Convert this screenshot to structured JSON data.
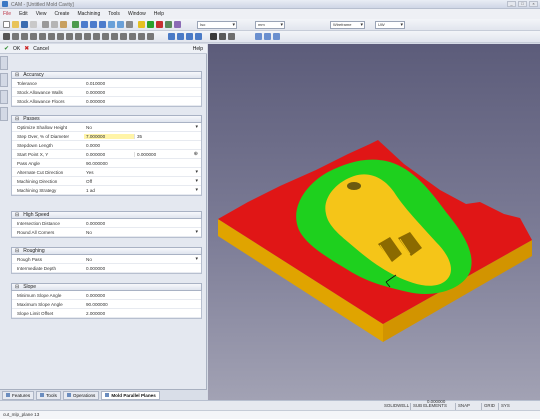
{
  "window": {
    "title": "CAM - [Untitled Mold Cavity]",
    "buttons": [
      "_",
      "□",
      "×"
    ]
  },
  "menu": [
    "File",
    "Edit",
    "View",
    "Create",
    "Machining",
    "Tools",
    "Window",
    "Help"
  ],
  "toolbar2": {
    "combo_view": "Iso",
    "combo_units": "mm",
    "combo_mode": "Wireframe",
    "combo_layer": "UW"
  },
  "panel": {
    "ok_label": "OK",
    "cancel_label": "Cancel",
    "help_label": "Help",
    "groups": {
      "accuracy": {
        "title": "Accuracy",
        "rows": [
          {
            "label": "Tolerance",
            "value": "0.010000"
          },
          {
            "label": "Stock Allowance Walls",
            "value": "0.000000"
          },
          {
            "label": "Stock Allowance Floors",
            "value": "0.000000"
          }
        ]
      },
      "passes": {
        "title": "Passes",
        "rows": [
          {
            "label": "Optimize Shallow Height",
            "value": "No"
          },
          {
            "label": "Step Over, % of Diameter",
            "value": "7.000000",
            "value2": "35"
          },
          {
            "label": "Stepdown Length",
            "value": "0.0000"
          },
          {
            "label": "Start Point X, Y",
            "value": "0.000000",
            "value2": "0.000000"
          },
          {
            "label": "Pass Angle",
            "value": "90.000000"
          },
          {
            "label": "Alternate Cut Direction",
            "value": "Yes"
          },
          {
            "label": "Machining Direction",
            "value": "Off"
          },
          {
            "label": "Machining Strategy",
            "value": "1 ad"
          }
        ]
      },
      "high_speed": {
        "title": "High Speed",
        "rows": [
          {
            "label": "Intersection Distance",
            "value": "0.000000"
          },
          {
            "label": "Round All Corners",
            "value": "No"
          }
        ]
      },
      "roughing": {
        "title": "Roughing",
        "rows": [
          {
            "label": "Rough Pass",
            "value": "No"
          },
          {
            "label": "Intermediate Depth",
            "value": "0.000000"
          }
        ]
      },
      "slope": {
        "title": "Slope",
        "rows": [
          {
            "label": "Minimum Slope Angle",
            "value": "0.000000"
          },
          {
            "label": "Maximum Slope Angle",
            "value": "90.000000"
          },
          {
            "label": "Slope Limit Offset",
            "value": "2.000000"
          }
        ]
      }
    },
    "tabs": [
      "Features",
      "Tools",
      "Operations",
      "Mold Parallel Planes"
    ]
  },
  "status": {
    "solid": "SOLIDWELL",
    "elements": "SUB ELEMENTS",
    "snap": "SNAP",
    "grid": "GRID",
    "right": "SYS",
    "coords": [
      "0.000000",
      "0.000000",
      "0.000000"
    ]
  },
  "command": "cut_mlp_plane 13",
  "colors": {
    "surface": "#e01616",
    "pocket": "#1ed01e",
    "part": "#f5c518",
    "side": "#e0a400"
  }
}
